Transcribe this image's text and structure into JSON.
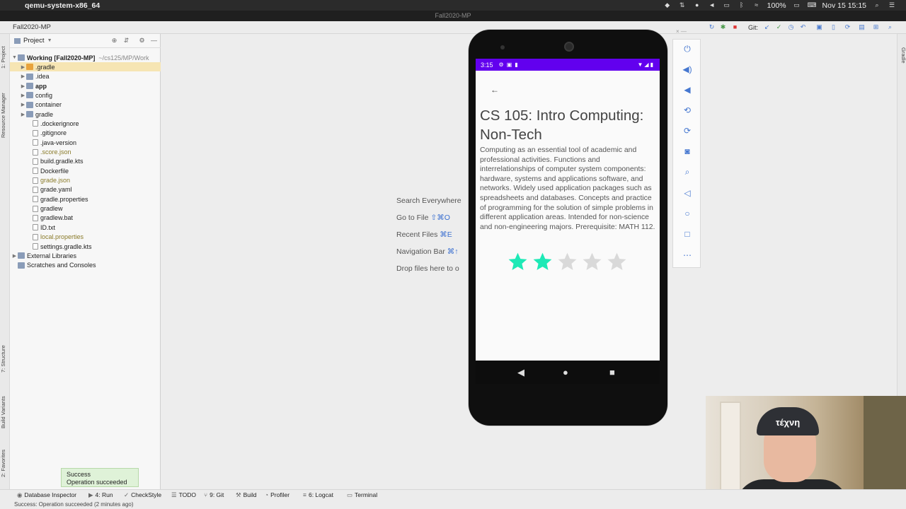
{
  "menubar": {
    "app_name": "qemu-system-x86_64",
    "battery": "100%",
    "datetime": "Nov 15  15:15"
  },
  "window": {
    "title": "Fall2020-MP"
  },
  "toolbar": {
    "project_name": "Fall2020-MP",
    "git_label": "Git:"
  },
  "side_stripe": {
    "project": "1: Project",
    "resource_manager": "Resource Manager",
    "structure": "7: Structure",
    "build_variants": "Build Variants",
    "favorites": "2: Favorites",
    "gradle": "Gradle"
  },
  "project_panel": {
    "header_label": "Project",
    "tree": [
      {
        "label": "Working [Fall2020-MP]",
        "extra": "~/cs125/MP/Work",
        "type": "root",
        "expanded": true
      },
      {
        "label": ".gradle",
        "type": "folder-orange",
        "selected": true
      },
      {
        "label": ".idea",
        "type": "folder"
      },
      {
        "label": "app",
        "type": "folder",
        "bold": true
      },
      {
        "label": "config",
        "type": "folder"
      },
      {
        "label": "container",
        "type": "folder"
      },
      {
        "label": "gradle",
        "type": "folder"
      },
      {
        "label": ".dockerignore",
        "type": "file"
      },
      {
        "label": ".gitignore",
        "type": "file"
      },
      {
        "label": ".java-version",
        "type": "file"
      },
      {
        "label": ".score.json",
        "type": "file",
        "style": "gold"
      },
      {
        "label": "build.gradle.kts",
        "type": "file"
      },
      {
        "label": "Dockerfile",
        "type": "file"
      },
      {
        "label": "grade.json",
        "type": "file",
        "style": "gold"
      },
      {
        "label": "grade.yaml",
        "type": "file"
      },
      {
        "label": "gradle.properties",
        "type": "file"
      },
      {
        "label": "gradlew",
        "type": "file"
      },
      {
        "label": "gradlew.bat",
        "type": "file"
      },
      {
        "label": "ID.txt",
        "type": "file"
      },
      {
        "label": "local.properties",
        "type": "file",
        "style": "gold"
      },
      {
        "label": "settings.gradle.kts",
        "type": "file"
      },
      {
        "label": "External Libraries",
        "type": "library"
      },
      {
        "label": "Scratches and Consoles",
        "type": "scratch"
      }
    ]
  },
  "editor_hints": {
    "search": "Search Everywhere",
    "goto_label": "Go to File",
    "goto_key": "⇧⌘O",
    "recent_label": "Recent Files",
    "recent_key": "⌘E",
    "navbar_label": "Navigation Bar",
    "navbar_key": "⌘↑",
    "drop": "Drop files here to o"
  },
  "device": {
    "time": "3:15",
    "course_title": "CS 105: Intro Computing: Non-Tech",
    "course_description": "Computing as an essential tool of academic and professional activities. Functions and interrelationships of computer system components: hardware, systems and applications software, and networks. Widely used application packages such as spreadsheets and databases. Concepts and practice of programming for the solution of simple problems in different application areas. Intended for non-science and non-engineering majors. Prerequisite: MATH 112.",
    "rating": 2,
    "rating_max": 5,
    "accent_color": "#6200ee",
    "star_on_color": "#1de9b6",
    "star_off_color": "#d9d9d9"
  },
  "toast": {
    "title": "Success",
    "message": "Operation succeeded"
  },
  "bottom_tools": [
    {
      "label": "Database Inspector",
      "icon": "database-icon"
    },
    {
      "label": "4: Run",
      "icon": "run-icon"
    },
    {
      "label": "CheckStyle",
      "icon": "checkstyle-icon"
    },
    {
      "label": "TODO",
      "icon": "todo-icon"
    },
    {
      "label": "9: Git",
      "icon": "git-icon"
    },
    {
      "label": "Build",
      "icon": "build-icon"
    },
    {
      "label": "Profiler",
      "icon": "profiler-icon"
    },
    {
      "label": "6: Logcat",
      "icon": "logcat-icon"
    },
    {
      "label": "Terminal",
      "icon": "terminal-icon"
    }
  ],
  "status_line": "Success: Operation succeeded (2 minutes ago)",
  "webcam": {
    "cap_text": "τέχνη"
  }
}
